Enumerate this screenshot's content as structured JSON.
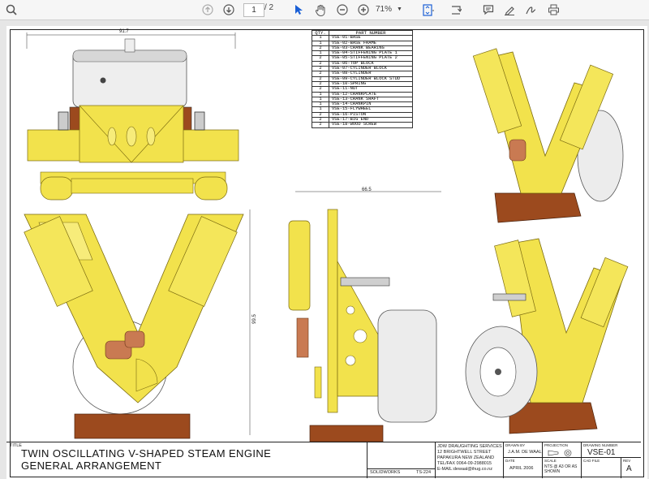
{
  "viewer": {
    "page_current": "1",
    "page_total": "/ 2",
    "zoom": "71%",
    "icons": [
      "search-icon",
      "page-up-icon",
      "page-down-icon",
      "zoom-out-icon",
      "zoom-in-icon",
      "select-cursor-icon",
      "hand-pan-icon",
      "fit-page-icon",
      "rotate-icon",
      "comment-icon",
      "draw-pen-icon",
      "sign-icon",
      "print-icon"
    ]
  },
  "drawing": {
    "parts_table": {
      "headers": [
        "QTY.",
        "PART NUMBER"
      ],
      "rows": [
        {
          "qty": "1",
          "part": "VSE-01-BASE"
        },
        {
          "qty": "1",
          "part": "VSE-02-BASE FRAME"
        },
        {
          "qty": "2",
          "part": "VSE-03-CRANK BEARING"
        },
        {
          "qty": "1",
          "part": "VSE-04-STIFFENING PLATE 1"
        },
        {
          "qty": "2",
          "part": "VSE-05-STIFFENING PLATE 2"
        },
        {
          "qty": "2",
          "part": "VSE-06-TOP BLOCK"
        },
        {
          "qty": "2",
          "part": "VSE-07-CYLINDER BLOCK"
        },
        {
          "qty": "2",
          "part": "VSE-08-CYLINDER"
        },
        {
          "qty": "2",
          "part": "VSE-09-CYLINDER BLOCK STUD"
        },
        {
          "qty": "2",
          "part": "VSE-10-SPRING"
        },
        {
          "qty": "2",
          "part": "VSE-11-NUT"
        },
        {
          "qty": "1",
          "part": "VSE-12-CRANKPLATE"
        },
        {
          "qty": "1",
          "part": "VSE-13-CRANK SHAFT"
        },
        {
          "qty": "1",
          "part": "VSE-14-CRANKPIN"
        },
        {
          "qty": "1",
          "part": "VSE-15-FLYWHEEL"
        },
        {
          "qty": "2",
          "part": "VSE-16-PISTON"
        },
        {
          "qty": "2",
          "part": "VSE-17-BIG END"
        },
        {
          "qty": "2",
          "part": "VSE-18-WOOD SCREW"
        }
      ]
    },
    "dims": {
      "top_width": "91.7",
      "side_width": "66.5",
      "front_height": "99.5"
    },
    "title_block": {
      "title_label": "TITLE",
      "title_line1": "TWIN OSCILLATING V-SHAPED STEAM ENGINE",
      "title_line2": "GENERAL ARRANGEMENT",
      "company_line1": "JDW DRAUGHTING SERVICES",
      "company_line2": "12 BRIGHTWELL STREET",
      "company_line3": "PAPAKURA NEW ZEALAND",
      "company_line4": "TEL/FAX 0064-09-2988015",
      "company_line5": "E-MAIL:dewaal@ihug.co.nz",
      "drawn_by_label": "DRAWN BY",
      "drawn_by": "J.A.M. DE WAAL",
      "date_label": "DATE",
      "date": "APRIL 2006",
      "projection_label": "PROJECTION",
      "scale_label": "SCALE",
      "scale": "NTS @ A3 OR AS SHOWN",
      "drawing_number_label": "DRAWING NUMBER",
      "drawing_number": "VSE-01",
      "cad_file_label": "CAD FILE",
      "rev_label": "REV",
      "rev": "A",
      "sheet_code": "SOLIDWORKS",
      "ts_code": "TS-224"
    },
    "colors": {
      "yellow": "#f2e24c",
      "yellow_dark": "#c9b42c",
      "wood": "#9c4a1e",
      "silver": "#e9e9e9",
      "copper": "#c97a52"
    }
  }
}
